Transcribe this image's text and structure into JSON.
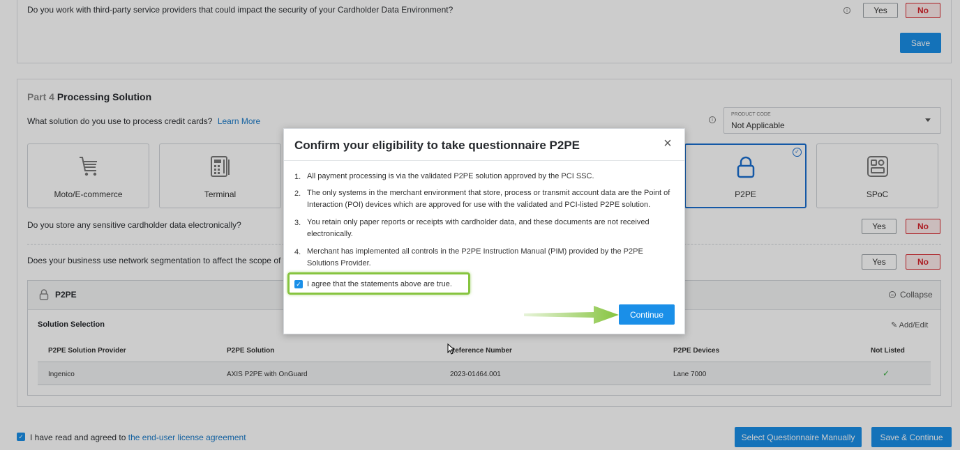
{
  "top_question": {
    "text": "Do you work with third-party service providers that could impact the security of your Cardholder Data Environment?",
    "yes": "Yes",
    "no": "No",
    "save": "Save"
  },
  "part4": {
    "prefix": "Part 4",
    "title": "Processing Solution",
    "question": "What solution do you use to process credit cards?",
    "learn_more": "Learn More",
    "product_code_label": "PRODUCT CODE",
    "product_code_value": "Not Applicable",
    "tiles": [
      {
        "label": "Moto/E-commerce",
        "icon": "cart-icon"
      },
      {
        "label": "Terminal",
        "icon": "terminal-icon"
      },
      {
        "label": "P2PE",
        "icon": "lock-icon"
      },
      {
        "label": "SPoC",
        "icon": "spoc-icon"
      }
    ]
  },
  "q_store": {
    "text": "Do you store any sensitive cardholder data electronically?",
    "yes": "Yes",
    "no": "No"
  },
  "q_segment": {
    "text": "Does your business use network segmentation to affect the scope of your PCI",
    "yes": "Yes",
    "no": "No"
  },
  "p2pe_section": {
    "title": "P2PE",
    "collapse": "Collapse",
    "solution_selection": "Solution Selection",
    "add_edit": "Add/Edit",
    "columns": [
      "P2PE Solution Provider",
      "P2PE Solution",
      "Reference Number",
      "P2PE Devices",
      "Not Listed"
    ],
    "row": [
      "Ingenico",
      "AXIS P2PE with OnGuard",
      "2023-01464.001",
      "Lane 7000"
    ]
  },
  "footer": {
    "agree_prefix": "I have read and agreed to",
    "agree_link": "the end-user license agreement",
    "select_manually": "Select Questionnaire Manually",
    "save_continue": "Save & Continue"
  },
  "modal": {
    "title": "Confirm your eligibility to take questionnaire P2PE",
    "items": [
      "All payment processing is via the validated P2PE solution approved by the PCI SSC.",
      "The only systems in the merchant environment that store, process or transmit account data are the Point of Interaction (POI) devices which are approved for use with the validated and PCI-listed P2PE solution.",
      "You retain only paper reports or receipts with cardholder data, and these documents are not received electronically.",
      "Merchant has implemented all controls in the P2PE Instruction Manual (PIM) provided by the P2PE Solutions Provider."
    ],
    "numbers": [
      "1.",
      "2.",
      "3.",
      "4."
    ],
    "agree": "I agree that the statements above are true.",
    "continue": "Continue"
  },
  "colors": {
    "primary": "#1a8fe8",
    "no_red": "#d7262e",
    "highlight_green": "#86c43f",
    "selected_border": "#1a6fd0"
  }
}
